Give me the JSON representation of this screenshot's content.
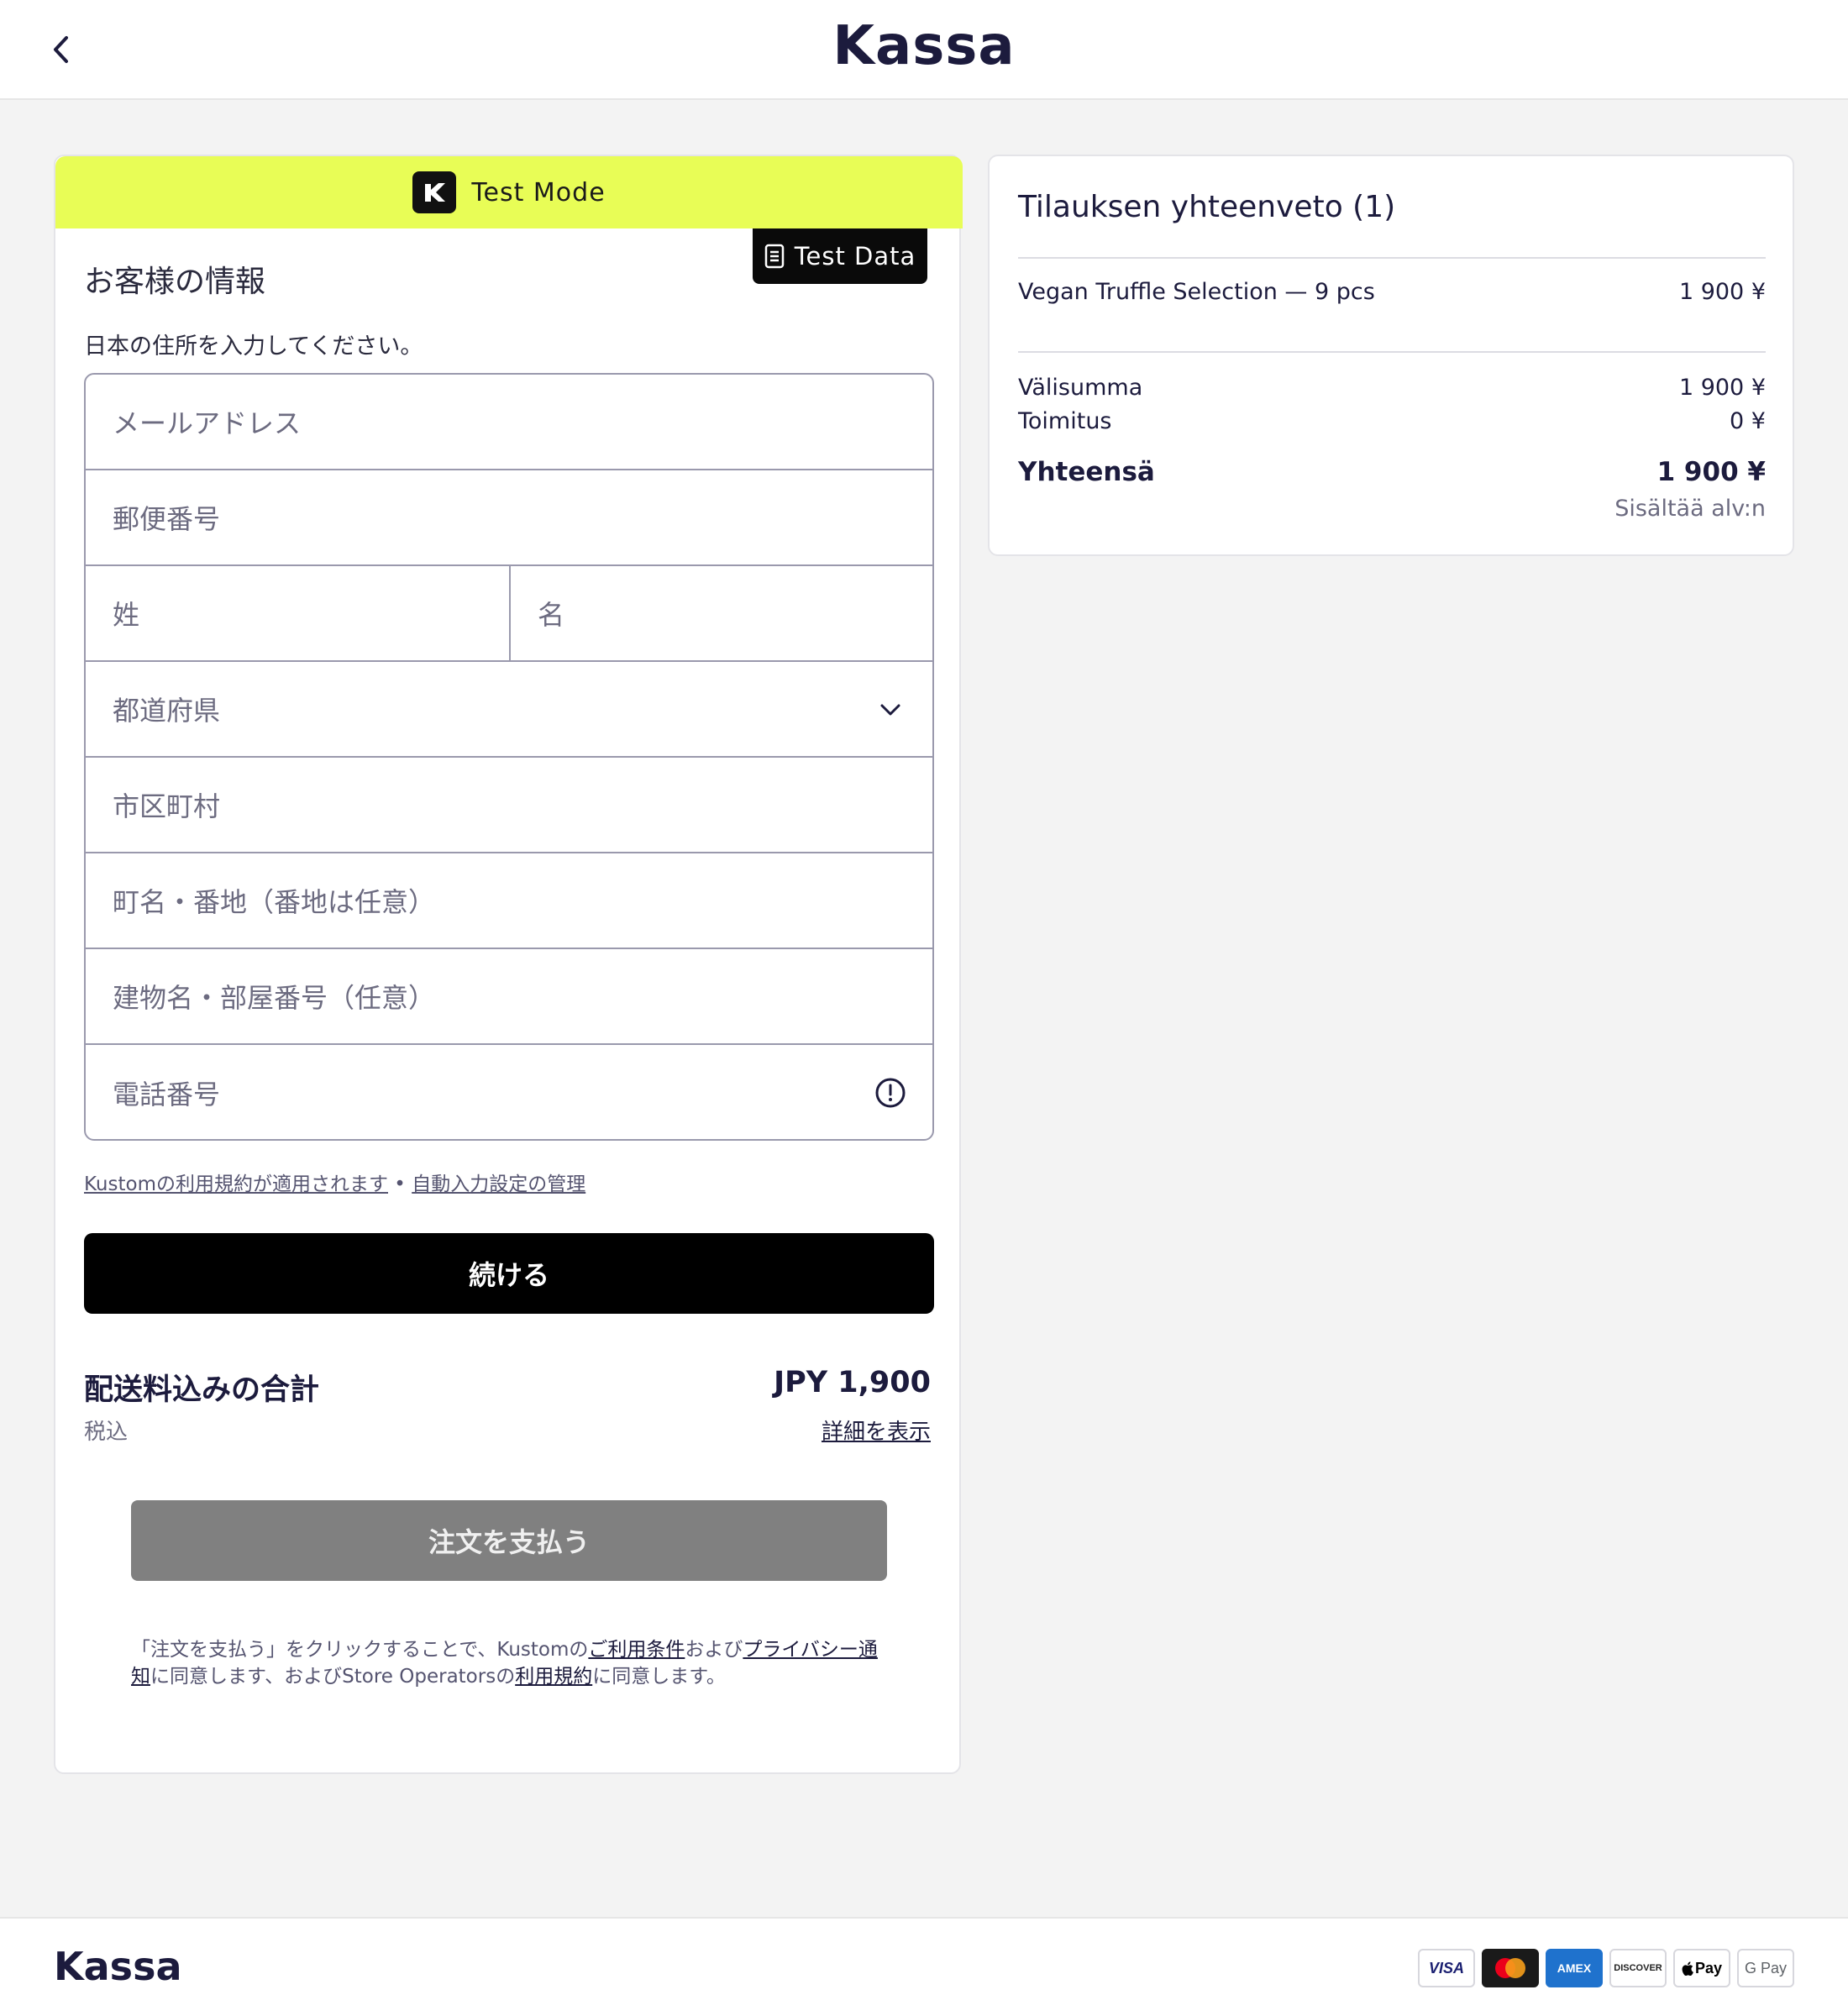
{
  "header": {
    "title": "Kassa"
  },
  "test_banner": {
    "label": "Test Mode",
    "test_data_label": "Test Data"
  },
  "customer": {
    "title": "お客様の情報",
    "description": "日本の住所を入力してください。",
    "fields": {
      "email": "メールアドレス",
      "postal": "郵便番号",
      "last_name": "姓",
      "first_name": "名",
      "prefecture": "都道府県",
      "city": "市区町村",
      "street": "町名・番地（番地は任意）",
      "building": "建物名・部屋番号（任意）",
      "phone": "電話番号"
    },
    "terms_link": "Kustomの利用規約が適用されます",
    "terms_sep": " • ",
    "autofill_link": "自動入力設定の管理",
    "continue_label": "続ける",
    "total_label": "配送料込みの合計",
    "total_sub": "税込",
    "total_value": "JPY 1,900",
    "details_link": "詳細を表示",
    "pay_label": "注文を支払う",
    "legal": {
      "p1": "「注文を支払う」をクリックすることで、Kustomの",
      "l1": "ご利用条件",
      "p2": "および",
      "l2": "プライバシー通知",
      "p3": "に同意します、およびStore Operatorsの",
      "l3": "利用規約",
      "p4": "に同意します。"
    }
  },
  "summary": {
    "title": "Tilauksen yhteenveto (1)",
    "item_name": "Vegan Truffle Selection — 9 pcs",
    "item_price": "1 900 ¥",
    "subtotal_label": "Välisumma",
    "subtotal_value": "1 900 ¥",
    "shipping_label": "Toimitus",
    "shipping_value": "0 ¥",
    "total_label": "Yhteensä",
    "total_value": "1 900 ¥",
    "vat_note": "Sisältää alv:n"
  },
  "footer": {
    "brand": "Kassa",
    "payment_methods": [
      "VISA",
      "Mastercard",
      "AMEX",
      "DISCOVER",
      "Pay",
      "G Pay"
    ]
  },
  "colors": {
    "test_banner": "#e8fd56",
    "brand_text": "#1c1b3d",
    "primary_button": "#000000",
    "disabled_button": "#808080"
  }
}
